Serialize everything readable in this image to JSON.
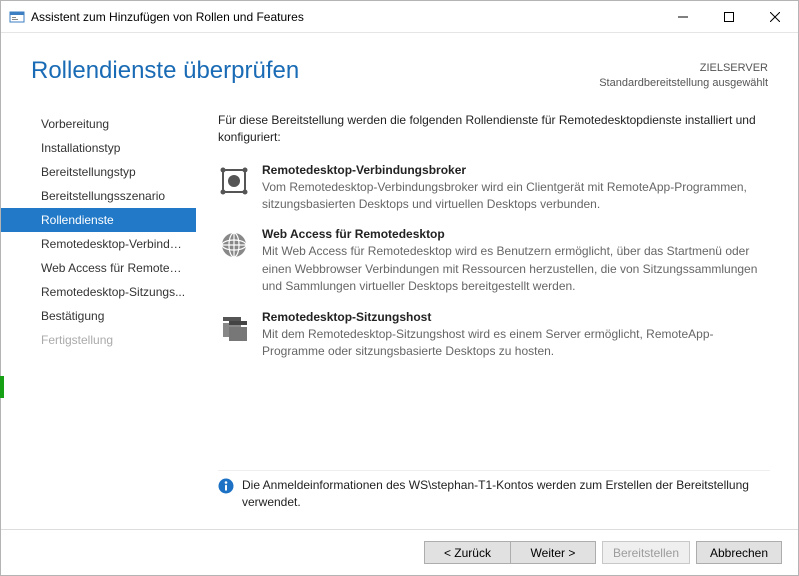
{
  "window": {
    "title": "Assistent zum Hinzufügen von Rollen und Features"
  },
  "header": {
    "title": "Rollendienste überprüfen",
    "target_label": "ZIELSERVER",
    "target_value": "Standardbereitstellung ausgewählt"
  },
  "sidebar": {
    "items": [
      {
        "label": "Vorbereitung"
      },
      {
        "label": "Installationstyp"
      },
      {
        "label": "Bereitstellungstyp"
      },
      {
        "label": "Bereitstellungsszenario"
      },
      {
        "label": "Rollendienste"
      },
      {
        "label": "Remotedesktop-Verbindu..."
      },
      {
        "label": "Web Access für Remoted..."
      },
      {
        "label": "Remotedesktop-Sitzungs..."
      },
      {
        "label": "Bestätigung"
      },
      {
        "label": "Fertigstellung"
      }
    ]
  },
  "content": {
    "intro": "Für diese Bereitstellung werden die folgenden Rollendienste für Remotedesktopdienste installiert und konfiguriert:",
    "roles": [
      {
        "title": "Remotedesktop-Verbindungsbroker",
        "desc": "Vom Remotedesktop-Verbindungsbroker wird ein Clientgerät mit RemoteApp-Programmen, sitzungsbasierten Desktops und virtuellen Desktops verbunden."
      },
      {
        "title": "Web Access für Remotedesktop",
        "desc": "Mit Web Access für Remotedesktop wird es Benutzern ermöglicht, über das Startmenü oder einen Webbrowser Verbindungen mit Ressourcen herzustellen, die von Sitzungssammlungen und Sammlungen virtueller Desktops bereitgestellt werden."
      },
      {
        "title": "Remotedesktop-Sitzungshost",
        "desc": "Mit dem Remotedesktop-Sitzungshost wird es einem Server ermöglicht, RemoteApp-Programme oder sitzungsbasierte Desktops zu hosten."
      }
    ],
    "info": "Die Anmeldeinformationen des WS\\stephan-T1-Kontos werden zum Erstellen der Bereitstellung verwendet."
  },
  "footer": {
    "back": "< Zurück",
    "next": "Weiter >",
    "deploy": "Bereitstellen",
    "cancel": "Abbrechen"
  }
}
